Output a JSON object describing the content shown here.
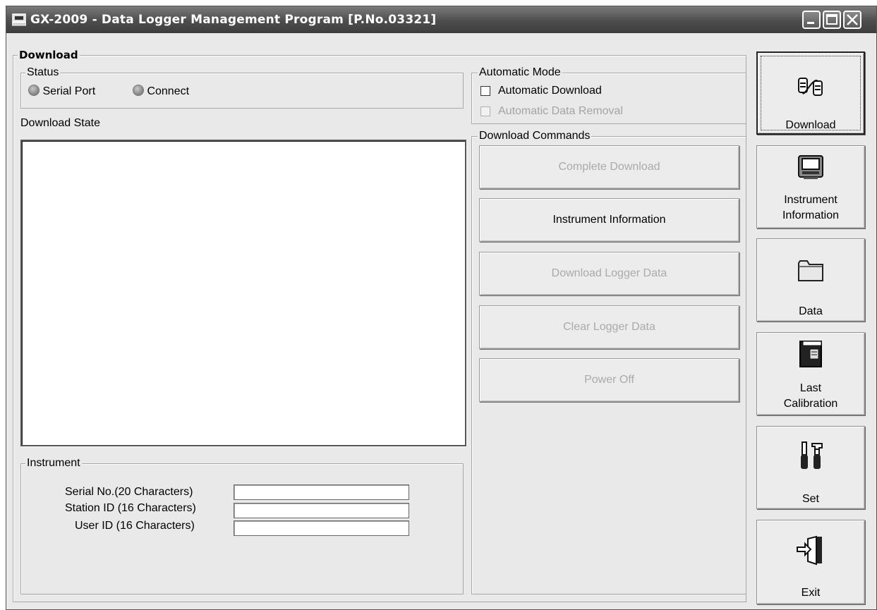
{
  "window": {
    "title": "GX-2009  - Data Logger Management Program [P.No.03321]"
  },
  "download_panel": {
    "legend": "Download",
    "status": {
      "legend": "Status",
      "serial_port_label": "Serial Port",
      "connect_label": "Connect"
    },
    "download_state_label": "Download State",
    "log_text": "",
    "instrument": {
      "legend": "Instrument",
      "serial_no_label": "Serial No.(20 Characters)",
      "serial_no_value": "",
      "station_id_label": "Station ID (16 Characters)",
      "station_id_value": "",
      "user_id_label": "User ID (16 Characters)",
      "user_id_value": ""
    }
  },
  "automatic_mode": {
    "legend": "Automatic Mode",
    "auto_download_label": "Automatic Download",
    "auto_download_checked": false,
    "auto_removal_label": "Automatic Data Removal",
    "auto_removal_checked": false
  },
  "download_commands": {
    "legend": "Download Commands",
    "complete_download": "Complete Download",
    "instrument_information": "Instrument Information",
    "download_logger_data": "Download Logger Data",
    "clear_logger_data": "Clear Logger Data",
    "power_off": "Power Off"
  },
  "sidebar": {
    "download": "Download",
    "instrument_information_line1": "Instrument",
    "instrument_information_line2": "Information",
    "data": "Data",
    "last_calibration_line1": "Last",
    "last_calibration_line2": "Calibration",
    "set": "Set",
    "exit": "Exit"
  },
  "icons": {
    "app": "computer-icon",
    "download": "serial-connector-icon",
    "instrument_information": "instrument-device-icon",
    "data": "folder-icon",
    "last_calibration": "calibration-book-icon",
    "set": "tools-icon",
    "exit": "exit-door-icon"
  }
}
